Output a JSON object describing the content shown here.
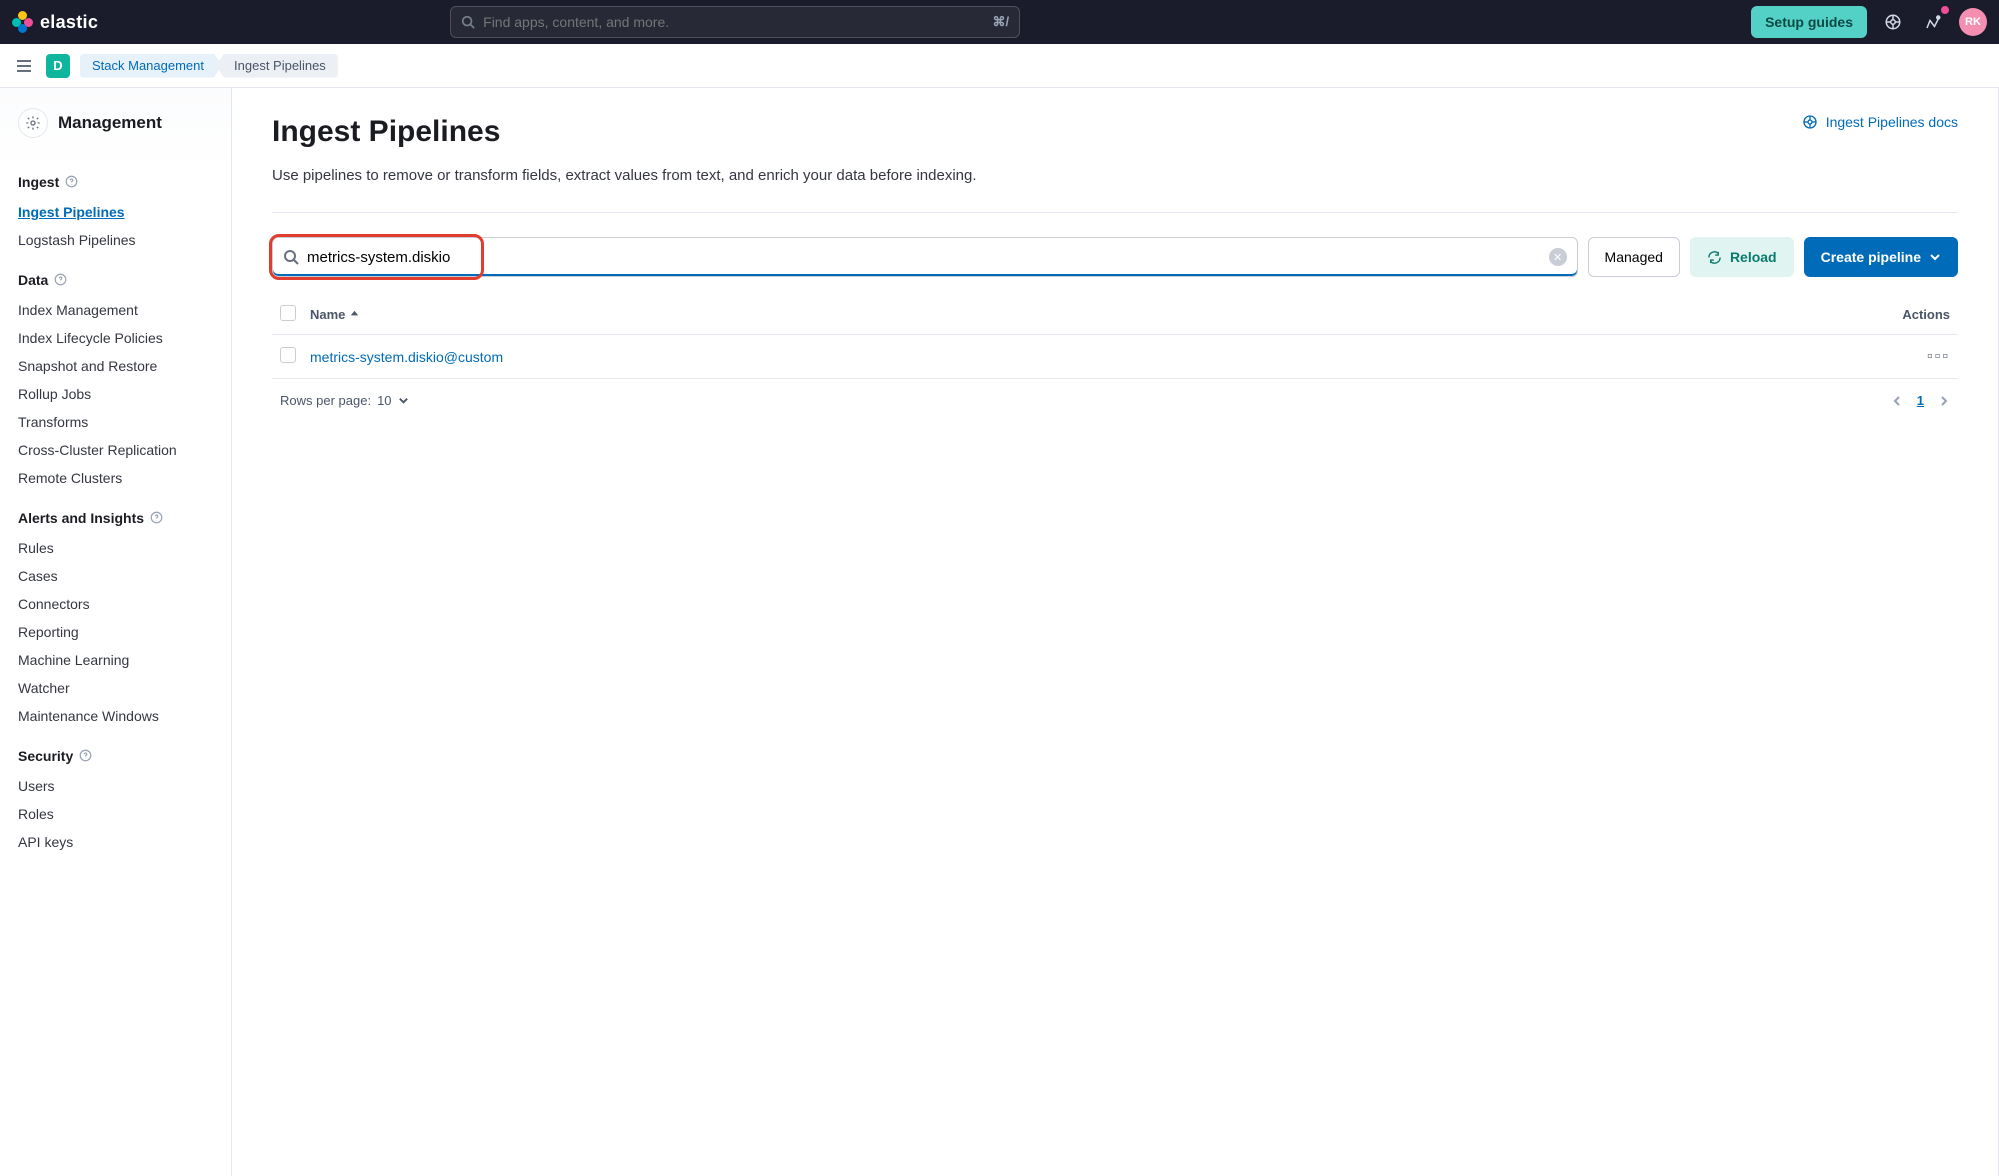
{
  "header": {
    "brand": "elastic",
    "search_placeholder": "Find apps, content, and more.",
    "search_shortcut": "⌘/",
    "setup_guides": "Setup guides",
    "avatar_initials": "RK"
  },
  "breadcrumb": {
    "space_initial": "D",
    "items": [
      "Stack Management",
      "Ingest Pipelines"
    ]
  },
  "sidebar": {
    "title": "Management",
    "sections": [
      {
        "label": "Ingest",
        "items": [
          {
            "label": "Ingest Pipelines",
            "active": true
          },
          {
            "label": "Logstash Pipelines"
          }
        ]
      },
      {
        "label": "Data",
        "items": [
          {
            "label": "Index Management"
          },
          {
            "label": "Index Lifecycle Policies"
          },
          {
            "label": "Snapshot and Restore"
          },
          {
            "label": "Rollup Jobs"
          },
          {
            "label": "Transforms"
          },
          {
            "label": "Cross-Cluster Replication"
          },
          {
            "label": "Remote Clusters"
          }
        ]
      },
      {
        "label": "Alerts and Insights",
        "items": [
          {
            "label": "Rules"
          },
          {
            "label": "Cases"
          },
          {
            "label": "Connectors"
          },
          {
            "label": "Reporting"
          },
          {
            "label": "Machine Learning"
          },
          {
            "label": "Watcher"
          },
          {
            "label": "Maintenance Windows"
          }
        ]
      },
      {
        "label": "Security",
        "items": [
          {
            "label": "Users"
          },
          {
            "label": "Roles"
          },
          {
            "label": "API keys"
          }
        ]
      }
    ]
  },
  "main": {
    "title": "Ingest Pipelines",
    "docs_link": "Ingest Pipelines docs",
    "description": "Use pipelines to remove or transform fields, extract values from text, and enrich your data before indexing.",
    "search_value": "metrics-system.diskio",
    "managed_label": "Managed",
    "reload_label": "Reload",
    "create_label": "Create pipeline",
    "table": {
      "col_name": "Name",
      "col_actions": "Actions",
      "rows": [
        {
          "name": "metrics-system.diskio@custom"
        }
      ],
      "rows_per_page_label": "Rows per page:",
      "rows_per_page_value": "10",
      "current_page": "1"
    }
  }
}
